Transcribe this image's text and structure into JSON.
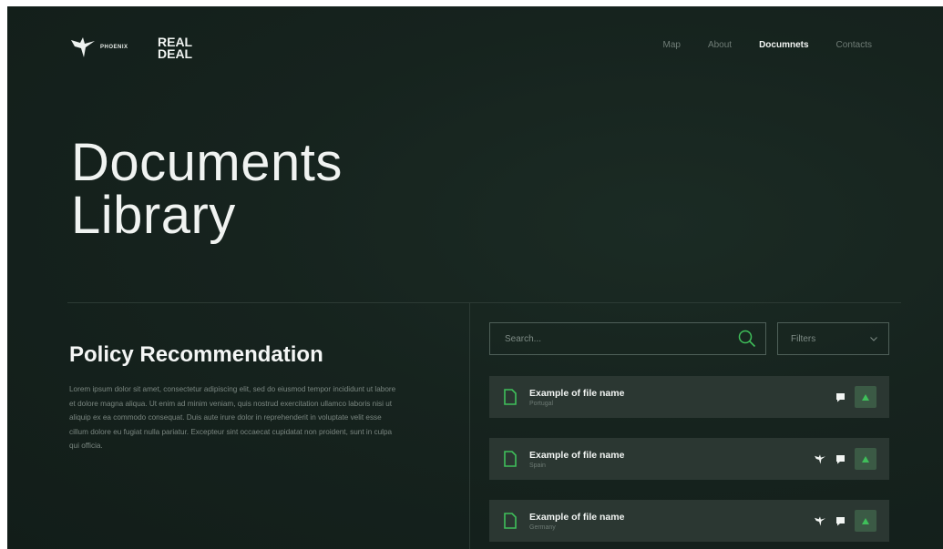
{
  "header": {
    "logo_phoenix": "PHOENIX",
    "logo_realdeal_line1": "REAL",
    "logo_realdeal_line2": "DEAL",
    "nav": [
      {
        "label": "Map",
        "active": false
      },
      {
        "label": "About",
        "active": false
      },
      {
        "label": "Documnets",
        "active": true
      },
      {
        "label": "Contacts",
        "active": false
      }
    ]
  },
  "hero": {
    "title_line1": "Documents",
    "title_line2": "Library"
  },
  "policy": {
    "title": "Policy Recommendation",
    "body": "Lorem ipsum dolor sit amet, consectetur adipiscing elit, sed do eiusmod tempor incididunt ut labore et dolore magna aliqua. Ut enim ad minim veniam, quis nostrud exercitation ullamco laboris nisi ut aliquip ex ea commodo consequat. Duis aute irure dolor in reprehenderit in voluptate velit esse cillum dolore eu fugiat nulla pariatur. Excepteur sint occaecat cupidatat non proident, sunt in culpa qui officia."
  },
  "search": {
    "placeholder": "Search...",
    "icon": "search-icon"
  },
  "filters": {
    "label": "Filters",
    "icon": "chevron-down-icon"
  },
  "files": [
    {
      "name": "Example of file name",
      "country": "Portugal",
      "icons": [
        "chat-bubble-icon"
      ],
      "action": "upload-arrow-icon"
    },
    {
      "name": "Example of file name",
      "country": "Spain",
      "icons": [
        "phoenix-bird-icon",
        "chat-bubble-icon"
      ],
      "action": "upload-arrow-icon"
    },
    {
      "name": "Example of file name",
      "country": "Germany",
      "icons": [
        "phoenix-bird-icon",
        "chat-bubble-icon"
      ],
      "action": "upload-arrow-icon"
    }
  ],
  "colors": {
    "background": "#16231e",
    "row_background": "#2b3732",
    "accent_green": "#3fbf5a",
    "button_green": "#3b5a45"
  }
}
